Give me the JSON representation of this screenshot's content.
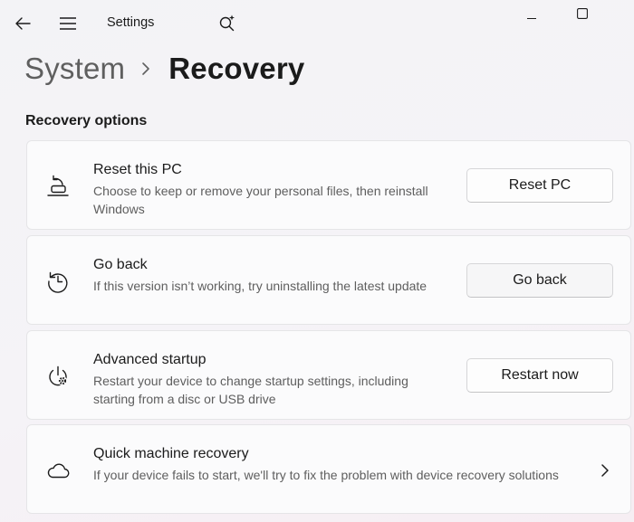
{
  "window": {
    "app_title": "Settings"
  },
  "breadcrumb": {
    "parent": "System",
    "current": "Recovery"
  },
  "section": {
    "title": "Recovery options"
  },
  "cards": [
    {
      "title": "Reset this PC",
      "desc": "Choose to keep or remove your personal files, then reinstall Windows",
      "button": "Reset PC",
      "icon": "reset-pc-icon"
    },
    {
      "title": "Go back",
      "desc": "If this version isn’t working, try uninstalling the latest update",
      "button": "Go back",
      "icon": "history-icon"
    },
    {
      "title": "Advanced startup",
      "desc": "Restart your device to change startup settings, including starting from a disc or USB drive",
      "button": "Restart now",
      "icon": "power-settings-icon"
    },
    {
      "title": "Quick machine recovery",
      "desc": "If your device fails to start, we'll try to fix the problem with device recovery solutions",
      "icon": "cloud-icon"
    }
  ],
  "colors": {
    "text": "#1b1b1b",
    "secondary_text": "#5e5e5e",
    "card_bg": "#fbfbfc",
    "card_border": "#e5e5e7"
  }
}
